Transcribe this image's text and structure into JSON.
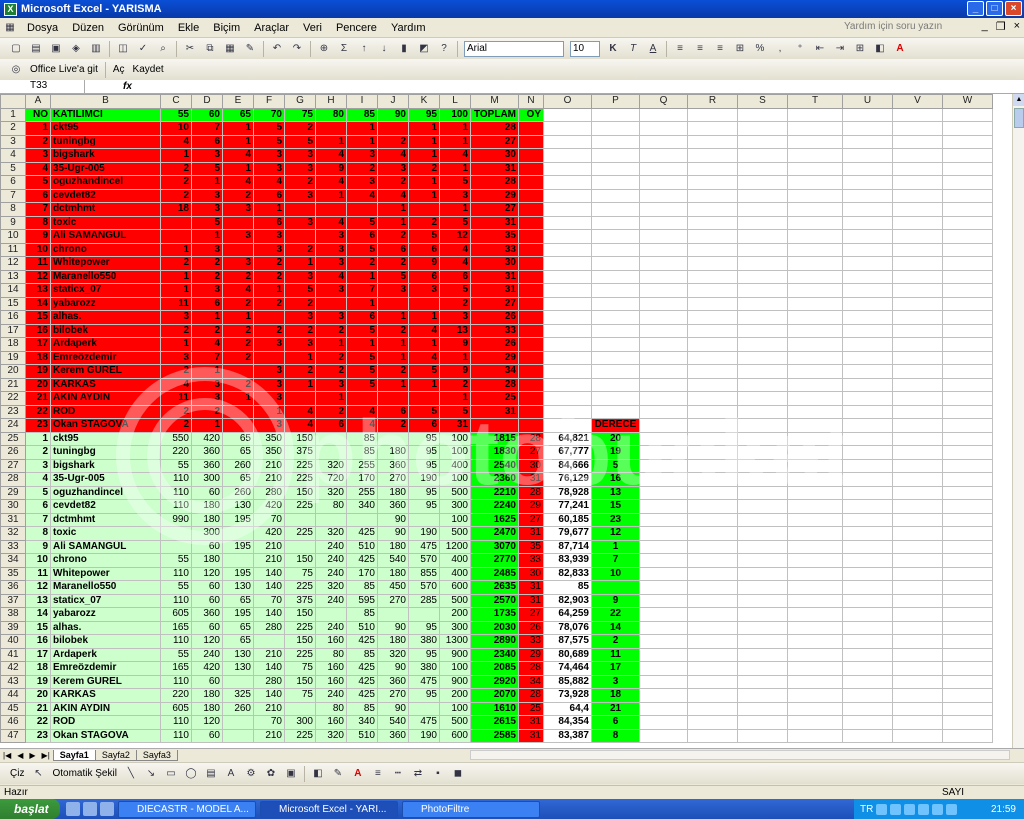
{
  "window": {
    "title": "Microsoft Excel - YARISMA"
  },
  "menus": [
    "Dosya",
    "Düzen",
    "Görünüm",
    "Ekle",
    "Biçim",
    "Araçlar",
    "Veri",
    "Pencere",
    "Yardım"
  ],
  "help_placeholder": "Yardım için soru yazın",
  "formatting": {
    "font": "Arial",
    "size": "10"
  },
  "toolbar2": {
    "office_live": "Office Live'a git",
    "open": "Aç",
    "save": "Kaydet"
  },
  "name_box": "T33",
  "fx": "fx",
  "columns": [
    "A",
    "B",
    "C",
    "D",
    "E",
    "F",
    "G",
    "H",
    "I",
    "J",
    "K",
    "L",
    "M",
    "N",
    "O",
    "P",
    "Q",
    "R",
    "S",
    "T",
    "U",
    "V",
    "W"
  ],
  "rows": [
    {
      "n": "1",
      "bg": "#00ff00",
      "c": [
        "NO",
        "KATILIMCI",
        "55",
        "60",
        "65",
        "70",
        "75",
        "80",
        "85",
        "90",
        "95",
        "100",
        "TOPLAM",
        "OY",
        "",
        "",
        "",
        "",
        "",
        "",
        "",
        "",
        ""
      ]
    },
    {
      "n": "2",
      "bg": "#ff0000",
      "c": [
        "1",
        "ckt95",
        "10",
        "7",
        "1",
        "5",
        "2",
        "",
        "1",
        "",
        "1",
        "1",
        "28",
        "",
        "",
        "",
        "",
        "",
        "",
        "",
        "",
        "",
        ""
      ]
    },
    {
      "n": "3",
      "bg": "#ff0000",
      "c": [
        "2",
        "tuningbg",
        "4",
        "6",
        "1",
        "5",
        "5",
        "1",
        "1",
        "2",
        "1",
        "1",
        "27",
        "",
        "",
        "",
        "",
        "",
        "",
        "",
        "",
        "",
        ""
      ]
    },
    {
      "n": "4",
      "bg": "#ff0000",
      "c": [
        "3",
        "bigshark",
        "1",
        "3",
        "4",
        "3",
        "3",
        "4",
        "3",
        "4",
        "1",
        "4",
        "30",
        "",
        "",
        "",
        "",
        "",
        "",
        "",
        "",
        "",
        ""
      ]
    },
    {
      "n": "5",
      "bg": "#ff0000",
      "c": [
        "4",
        "35-Ugr-005",
        "2",
        "5",
        "1",
        "3",
        "3",
        "9",
        "2",
        "3",
        "2",
        "1",
        "31",
        "",
        "",
        "",
        "",
        "",
        "",
        "",
        "",
        "",
        ""
      ]
    },
    {
      "n": "6",
      "bg": "#ff0000",
      "c": [
        "5",
        "oguzhandincel",
        "2",
        "1",
        "4",
        "4",
        "2",
        "4",
        "3",
        "2",
        "1",
        "5",
        "28",
        "",
        "",
        "",
        "",
        "",
        "",
        "",
        "",
        "",
        ""
      ]
    },
    {
      "n": "7",
      "bg": "#ff0000",
      "c": [
        "6",
        "cevdet82",
        "2",
        "3",
        "2",
        "6",
        "3",
        "1",
        "4",
        "4",
        "1",
        "3",
        "29",
        "",
        "",
        "",
        "",
        "",
        "",
        "",
        "",
        "",
        ""
      ]
    },
    {
      "n": "8",
      "bg": "#ff0000",
      "c": [
        "7",
        "dctmhmt",
        "18",
        "3",
        "3",
        "1",
        "",
        "",
        "",
        "1",
        "",
        "1",
        "27",
        "",
        "",
        "",
        "",
        "",
        "",
        "",
        "",
        "",
        ""
      ]
    },
    {
      "n": "9",
      "bg": "#ff0000",
      "c": [
        "8",
        "toxic",
        "",
        "5",
        "",
        "6",
        "3",
        "4",
        "5",
        "1",
        "2",
        "5",
        "31",
        "",
        "",
        "",
        "",
        "",
        "",
        "",
        "",
        "",
        ""
      ]
    },
    {
      "n": "10",
      "bg": "#ff0000",
      "c": [
        "9",
        "Ali SAMANGÜL",
        "",
        "1",
        "3",
        "3",
        "",
        "3",
        "6",
        "2",
        "5",
        "12",
        "35",
        "",
        "",
        "",
        "",
        "",
        "",
        "",
        "",
        "",
        ""
      ]
    },
    {
      "n": "11",
      "bg": "#ff0000",
      "c": [
        "10",
        "chrono",
        "1",
        "3",
        "",
        "3",
        "2",
        "3",
        "5",
        "6",
        "6",
        "4",
        "33",
        "",
        "",
        "",
        "",
        "",
        "",
        "",
        "",
        "",
        ""
      ]
    },
    {
      "n": "12",
      "bg": "#ff0000",
      "c": [
        "11",
        "Whitepower",
        "2",
        "2",
        "3",
        "2",
        "1",
        "3",
        "2",
        "2",
        "9",
        "4",
        "30",
        "",
        "",
        "",
        "",
        "",
        "",
        "",
        "",
        "",
        ""
      ]
    },
    {
      "n": "13",
      "bg": "#ff0000",
      "c": [
        "12",
        "Maranello550",
        "1",
        "2",
        "2",
        "2",
        "3",
        "4",
        "1",
        "5",
        "6",
        "6",
        "31",
        "",
        "",
        "",
        "",
        "",
        "",
        "",
        "",
        "",
        ""
      ]
    },
    {
      "n": "14",
      "bg": "#ff0000",
      "c": [
        "13",
        "staticx_07",
        "1",
        "3",
        "4",
        "1",
        "5",
        "3",
        "7",
        "3",
        "3",
        "5",
        "31",
        "",
        "",
        "",
        "",
        "",
        "",
        "",
        "",
        "",
        ""
      ]
    },
    {
      "n": "15",
      "bg": "#ff0000",
      "c": [
        "14",
        "yabarozz",
        "11",
        "6",
        "2",
        "2",
        "2",
        "",
        "1",
        "",
        "",
        "2",
        "27",
        "",
        "",
        "",
        "",
        "",
        "",
        "",
        "",
        "",
        ""
      ]
    },
    {
      "n": "16",
      "bg": "#ff0000",
      "c": [
        "15",
        "alhas.",
        "3",
        "1",
        "1",
        "",
        "3",
        "3",
        "6",
        "1",
        "1",
        "3",
        "26",
        "",
        "",
        "",
        "",
        "",
        "",
        "",
        "",
        "",
        ""
      ]
    },
    {
      "n": "17",
      "bg": "#ff0000",
      "c": [
        "16",
        "bilobek",
        "2",
        "2",
        "2",
        "2",
        "2",
        "2",
        "5",
        "2",
        "4",
        "13",
        "33",
        "",
        "",
        "",
        "",
        "",
        "",
        "",
        "",
        "",
        ""
      ]
    },
    {
      "n": "18",
      "bg": "#ff0000",
      "c": [
        "17",
        "Ardaperk",
        "1",
        "4",
        "2",
        "3",
        "3",
        "1",
        "1",
        "1",
        "1",
        "9",
        "26",
        "",
        "",
        "",
        "",
        "",
        "",
        "",
        "",
        "",
        ""
      ]
    },
    {
      "n": "19",
      "bg": "#ff0000",
      "c": [
        "18",
        "Emreözdemir",
        "3",
        "7",
        "2",
        "",
        "1",
        "2",
        "5",
        "1",
        "4",
        "1",
        "29",
        "",
        "",
        "",
        "",
        "",
        "",
        "",
        "",
        "",
        ""
      ]
    },
    {
      "n": "20",
      "bg": "#ff0000",
      "c": [
        "19",
        "Kerem GÜREL",
        "2",
        "1",
        "",
        "3",
        "2",
        "2",
        "5",
        "2",
        "5",
        "9",
        "34",
        "",
        "",
        "",
        "",
        "",
        "",
        "",
        "",
        "",
        ""
      ]
    },
    {
      "n": "21",
      "bg": "#ff0000",
      "c": [
        "20",
        "KARKAS",
        "4",
        "3",
        "2",
        "3",
        "1",
        "3",
        "5",
        "1",
        "1",
        "2",
        "28",
        "",
        "",
        "",
        "",
        "",
        "",
        "",
        "",
        "",
        ""
      ]
    },
    {
      "n": "22",
      "bg": "#ff0000",
      "c": [
        "21",
        "AKIN AYDIN",
        "11",
        "3",
        "1",
        "3",
        "",
        "1",
        "",
        "",
        "",
        "1",
        "25",
        "",
        "",
        "",
        "",
        "",
        "",
        "",
        "",
        "",
        ""
      ]
    },
    {
      "n": "23",
      "bg": "#ff0000",
      "c": [
        "22",
        "ROD",
        "2",
        "2",
        "",
        "1",
        "4",
        "2",
        "4",
        "6",
        "5",
        "5",
        "31",
        "",
        "",
        "",
        "",
        "",
        "",
        "",
        "",
        "",
        ""
      ]
    },
    {
      "n": "24",
      "bg": "#ff0000",
      "c": [
        "23",
        "Okan STAGOVA",
        "2",
        "1",
        "",
        "3",
        "4",
        "6",
        "4",
        "2",
        "6",
        "31",
        "",
        "",
        "",
        "DERECE",
        "",
        "",
        "",
        "",
        "",
        "",
        ""
      ]
    },
    {
      "n": "25",
      "bg": "#ccffcc",
      "c": [
        "1",
        "ckt95",
        "550",
        "420",
        "65",
        "350",
        "150",
        "",
        "85",
        "",
        "95",
        "100",
        "1815",
        "28",
        "64,821",
        "20",
        "",
        "",
        "",
        "",
        "",
        "",
        ""
      ]
    },
    {
      "n": "26",
      "bg": "#ccffcc",
      "c": [
        "2",
        "tuningbg",
        "220",
        "360",
        "65",
        "350",
        "375",
        "",
        "85",
        "180",
        "95",
        "100",
        "1830",
        "27",
        "67,777",
        "19",
        "",
        "",
        "",
        "",
        "",
        "",
        ""
      ]
    },
    {
      "n": "27",
      "bg": "#ccffcc",
      "c": [
        "3",
        "bigshark",
        "55",
        "360",
        "260",
        "210",
        "225",
        "320",
        "255",
        "360",
        "95",
        "400",
        "2540",
        "30",
        "84,666",
        "5",
        "",
        "",
        "",
        "",
        "",
        "",
        ""
      ]
    },
    {
      "n": "28",
      "bg": "#ccffcc",
      "c": [
        "4",
        "35-Ugr-005",
        "110",
        "300",
        "65",
        "210",
        "225",
        "720",
        "170",
        "270",
        "190",
        "100",
        "2360",
        "31",
        "76,129",
        "16",
        "",
        "",
        "",
        "",
        "",
        "",
        ""
      ]
    },
    {
      "n": "29",
      "bg": "#ccffcc",
      "c": [
        "5",
        "oguzhandincel",
        "110",
        "60",
        "260",
        "280",
        "150",
        "320",
        "255",
        "180",
        "95",
        "500",
        "2210",
        "28",
        "78,928",
        "13",
        "",
        "",
        "",
        "",
        "",
        "",
        ""
      ]
    },
    {
      "n": "30",
      "bg": "#ccffcc",
      "c": [
        "6",
        "cevdet82",
        "110",
        "180",
        "130",
        "420",
        "225",
        "80",
        "340",
        "360",
        "95",
        "300",
        "2240",
        "29",
        "77,241",
        "15",
        "",
        "",
        "",
        "",
        "",
        "",
        ""
      ]
    },
    {
      "n": "31",
      "bg": "#ccffcc",
      "c": [
        "7",
        "dctmhmt",
        "990",
        "180",
        "195",
        "70",
        "",
        "",
        "",
        "90",
        "",
        "100",
        "1625",
        "27",
        "60,185",
        "23",
        "",
        "",
        "",
        "",
        "",
        "",
        ""
      ]
    },
    {
      "n": "32",
      "bg": "#ccffcc",
      "c": [
        "8",
        "toxic",
        "",
        "300",
        "",
        "420",
        "225",
        "320",
        "425",
        "90",
        "190",
        "500",
        "2470",
        "31",
        "79,677",
        "12",
        "",
        "",
        "",
        "",
        "",
        "",
        ""
      ]
    },
    {
      "n": "33",
      "bg": "#ccffcc",
      "c": [
        "9",
        "Ali SAMANGÜL",
        "",
        "60",
        "195",
        "210",
        "",
        "240",
        "510",
        "180",
        "475",
        "1200",
        "3070",
        "35",
        "87,714",
        "1",
        "",
        "",
        "",
        "",
        "",
        "",
        ""
      ]
    },
    {
      "n": "34",
      "bg": "#ccffcc",
      "c": [
        "10",
        "chrono",
        "55",
        "180",
        "",
        "210",
        "150",
        "240",
        "425",
        "540",
        "570",
        "400",
        "2770",
        "33",
        "83,939",
        "7",
        "",
        "",
        "",
        "",
        "",
        "",
        ""
      ]
    },
    {
      "n": "35",
      "bg": "#ccffcc",
      "c": [
        "11",
        "Whitepower",
        "110",
        "120",
        "195",
        "140",
        "75",
        "240",
        "170",
        "180",
        "855",
        "400",
        "2485",
        "30",
        "82,833",
        "10",
        "",
        "",
        "",
        "",
        "",
        "",
        ""
      ]
    },
    {
      "n": "36",
      "bg": "#ccffcc",
      "c": [
        "12",
        "Maranello550",
        "55",
        "60",
        "130",
        "140",
        "225",
        "320",
        "85",
        "450",
        "570",
        "600",
        "2635",
        "31",
        "85",
        "",
        "",
        "",
        "",
        "",
        "",
        "",
        ""
      ]
    },
    {
      "n": "37",
      "bg": "#ccffcc",
      "c": [
        "13",
        "staticx_07",
        "110",
        "60",
        "65",
        "70",
        "375",
        "240",
        "595",
        "270",
        "285",
        "500",
        "2570",
        "31",
        "82,903",
        "9",
        "",
        "",
        "",
        "",
        "",
        "",
        ""
      ]
    },
    {
      "n": "38",
      "bg": "#ccffcc",
      "c": [
        "14",
        "yabarozz",
        "605",
        "360",
        "195",
        "140",
        "150",
        "",
        "85",
        "",
        "",
        "200",
        "1735",
        "27",
        "64,259",
        "22",
        "",
        "",
        "",
        "",
        "",
        "",
        ""
      ]
    },
    {
      "n": "39",
      "bg": "#ccffcc",
      "c": [
        "15",
        "alhas.",
        "165",
        "60",
        "65",
        "280",
        "225",
        "240",
        "510",
        "90",
        "95",
        "300",
        "2030",
        "26",
        "78,076",
        "14",
        "",
        "",
        "",
        "",
        "",
        "",
        ""
      ]
    },
    {
      "n": "40",
      "bg": "#ccffcc",
      "c": [
        "16",
        "bilobek",
        "110",
        "120",
        "65",
        "",
        "150",
        "160",
        "425",
        "180",
        "380",
        "1300",
        "2890",
        "33",
        "87,575",
        "2",
        "",
        "",
        "",
        "",
        "",
        "",
        ""
      ]
    },
    {
      "n": "41",
      "bg": "#ccffcc",
      "c": [
        "17",
        "Ardaperk",
        "55",
        "240",
        "130",
        "210",
        "225",
        "80",
        "85",
        "320",
        "95",
        "900",
        "2340",
        "29",
        "80,689",
        "11",
        "",
        "",
        "",
        "",
        "",
        "",
        ""
      ]
    },
    {
      "n": "42",
      "bg": "#ccffcc",
      "c": [
        "18",
        "Emreözdemir",
        "165",
        "420",
        "130",
        "140",
        "75",
        "160",
        "425",
        "90",
        "380",
        "100",
        "2085",
        "28",
        "74,464",
        "17",
        "",
        "",
        "",
        "",
        "",
        "",
        ""
      ]
    },
    {
      "n": "43",
      "bg": "#ccffcc",
      "c": [
        "19",
        "Kerem GÜREL",
        "110",
        "60",
        "",
        "280",
        "150",
        "160",
        "425",
        "360",
        "475",
        "900",
        "2920",
        "34",
        "85,882",
        "3",
        "",
        "",
        "",
        "",
        "",
        "",
        ""
      ]
    },
    {
      "n": "44",
      "bg": "#ccffcc",
      "c": [
        "20",
        "KARKAS",
        "220",
        "180",
        "325",
        "140",
        "75",
        "240",
        "425",
        "270",
        "95",
        "200",
        "2070",
        "28",
        "73,928",
        "18",
        "",
        "",
        "",
        "",
        "",
        "",
        ""
      ]
    },
    {
      "n": "45",
      "bg": "#ccffcc",
      "c": [
        "21",
        "AKIN AYDIN",
        "605",
        "180",
        "260",
        "210",
        "",
        "80",
        "85",
        "90",
        "",
        "100",
        "1610",
        "25",
        "64,4",
        "21",
        "",
        "",
        "",
        "",
        "",
        "",
        ""
      ]
    },
    {
      "n": "46",
      "bg": "#ccffcc",
      "c": [
        "22",
        "ROD",
        "110",
        "120",
        "",
        "70",
        "300",
        "160",
        "340",
        "540",
        "475",
        "500",
        "2615",
        "31",
        "84,354",
        "6",
        "",
        "",
        "",
        "",
        "",
        "",
        ""
      ]
    },
    {
      "n": "47",
      "bg": "#ccffcc",
      "c": [
        "23",
        "Okan STAGOVA",
        "110",
        "60",
        "",
        "210",
        "225",
        "320",
        "510",
        "360",
        "190",
        "600",
        "2585",
        "31",
        "83,387",
        "8",
        "",
        "",
        "",
        "",
        "",
        "",
        ""
      ]
    }
  ],
  "sheet_tabs": [
    "Sayfa1",
    "Sayfa2",
    "Sayfa3"
  ],
  "drawbar": {
    "draw": "Çiz",
    "autoshapes": "Otomatik Şekil"
  },
  "status": {
    "left": "Hazır",
    "right": "SAYI"
  },
  "taskbar": {
    "start": "başlat",
    "tasks": [
      "DIECASTR - MODEL A...",
      "Microsoft Excel - YARI...",
      "PhotoFiltre"
    ],
    "lang": "TR",
    "clock": "21:59"
  },
  "watermark": "photobucket",
  "colors": {
    "green": "#00ff00",
    "red": "#ff0000",
    "light_green": "#ccffcc",
    "title_blue": "#0a4fd6"
  }
}
